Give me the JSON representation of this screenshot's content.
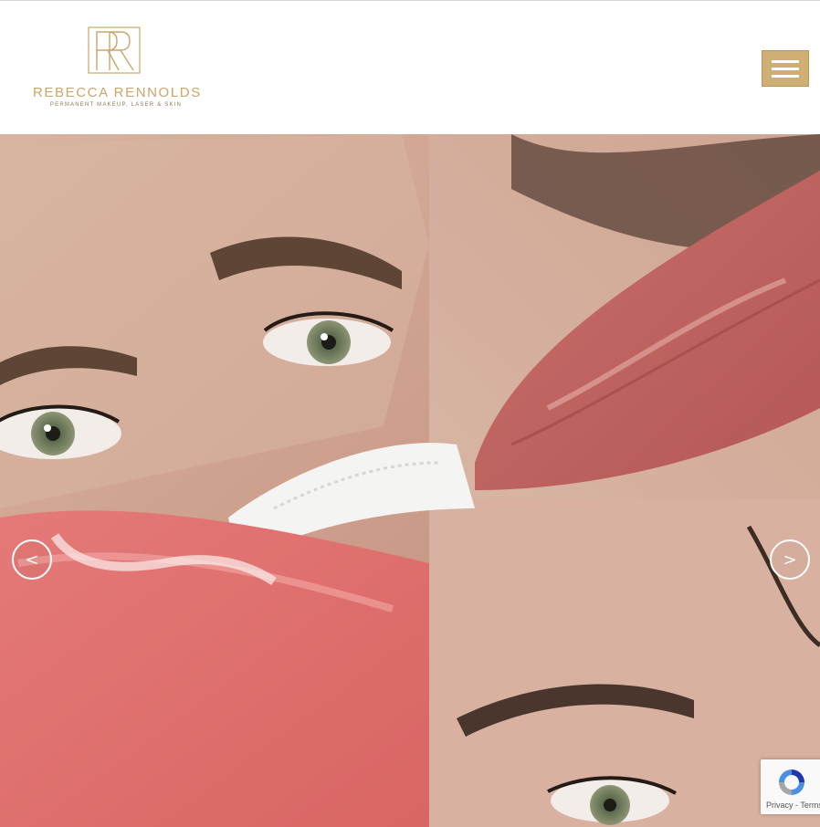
{
  "brand": {
    "name": "REBECCA RENNOLDS",
    "tagline": "PERMANENT MAKEUP, LASER & SKIN",
    "gold": "#c9a66b"
  },
  "header": {
    "menu_icon": "hamburger-menu-icon",
    "menu_color": "#cfaf74"
  },
  "slider": {
    "prev_label": "<",
    "next_label": ">"
  },
  "recaptcha": {
    "privacy_label": "Privacy",
    "separator": " - ",
    "terms_label": "Terms"
  }
}
